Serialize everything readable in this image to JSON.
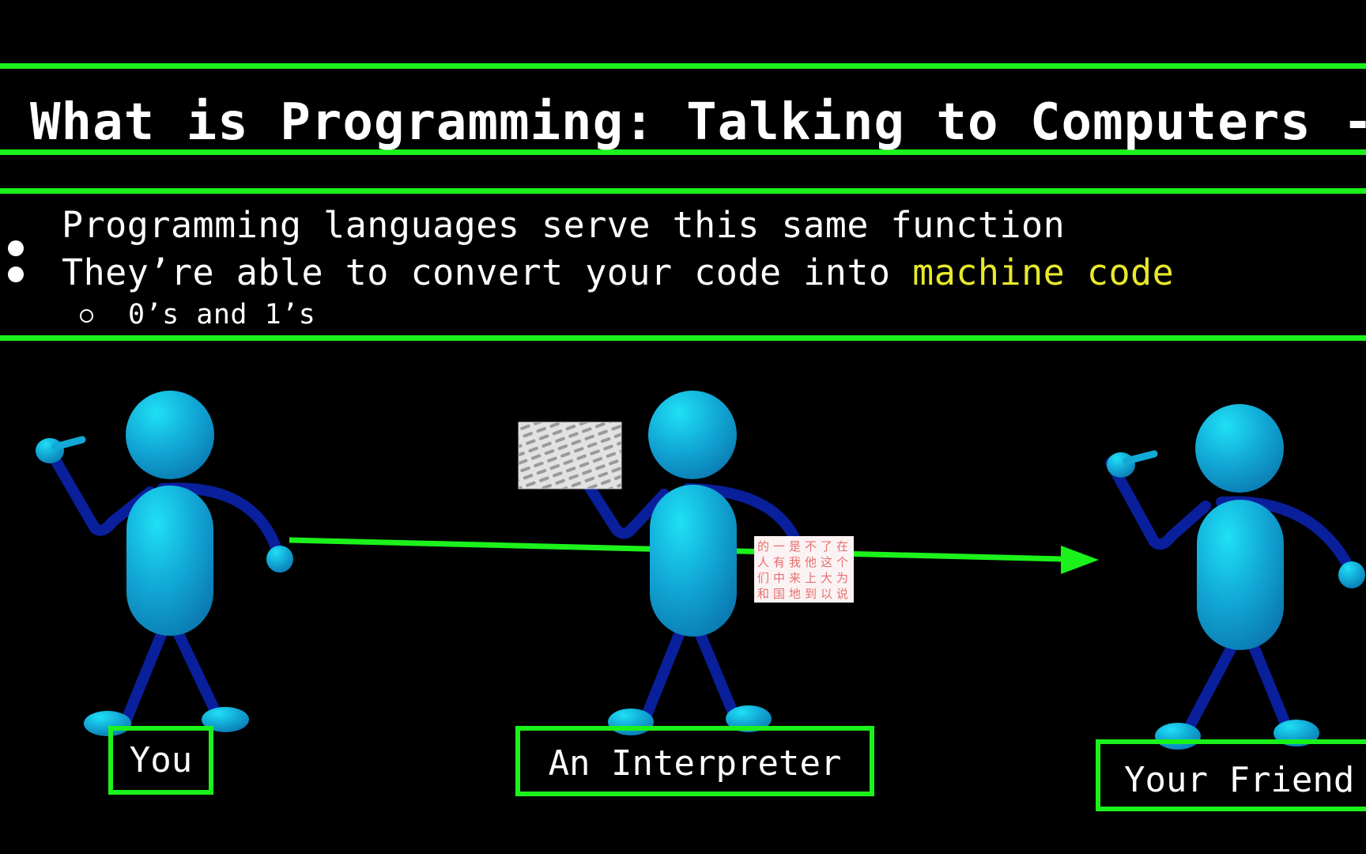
{
  "slide": {
    "title": "What is Programming: Talking to Computers -",
    "bullets": [
      {
        "text": "Programming languages serve this same function"
      },
      {
        "text_before": "They’re able to convert your code into ",
        "highlight": "machine code"
      }
    ],
    "sub_bullets": [
      {
        "text": "0’s and 1’s"
      }
    ],
    "colors": {
      "background": "#000000",
      "accent_green": "#1bf21b",
      "highlight_yellow": "#e8e82a",
      "figure_body": "#12a9d6",
      "figure_limbs": "#0a1f9c"
    }
  },
  "diagram": {
    "figures": [
      {
        "label": "You",
        "pose": "pointing-self"
      },
      {
        "label": "An Interpreter",
        "pose": "holding-cards",
        "cards": [
          "english-text-card",
          "chinese-text-card"
        ]
      },
      {
        "label": "Your Friend",
        "pose": "pointing-self"
      }
    ],
    "arrow": "from You to Your Friend through An Interpreter",
    "chinese_card_chars": [
      "的",
      "一",
      "是",
      "不",
      "了",
      "在",
      "人",
      "有",
      "我",
      "他",
      "这",
      "个",
      "们",
      "中",
      "来",
      "上",
      "大",
      "为",
      "和",
      "国",
      "地",
      "到",
      "以",
      "说"
    ]
  }
}
